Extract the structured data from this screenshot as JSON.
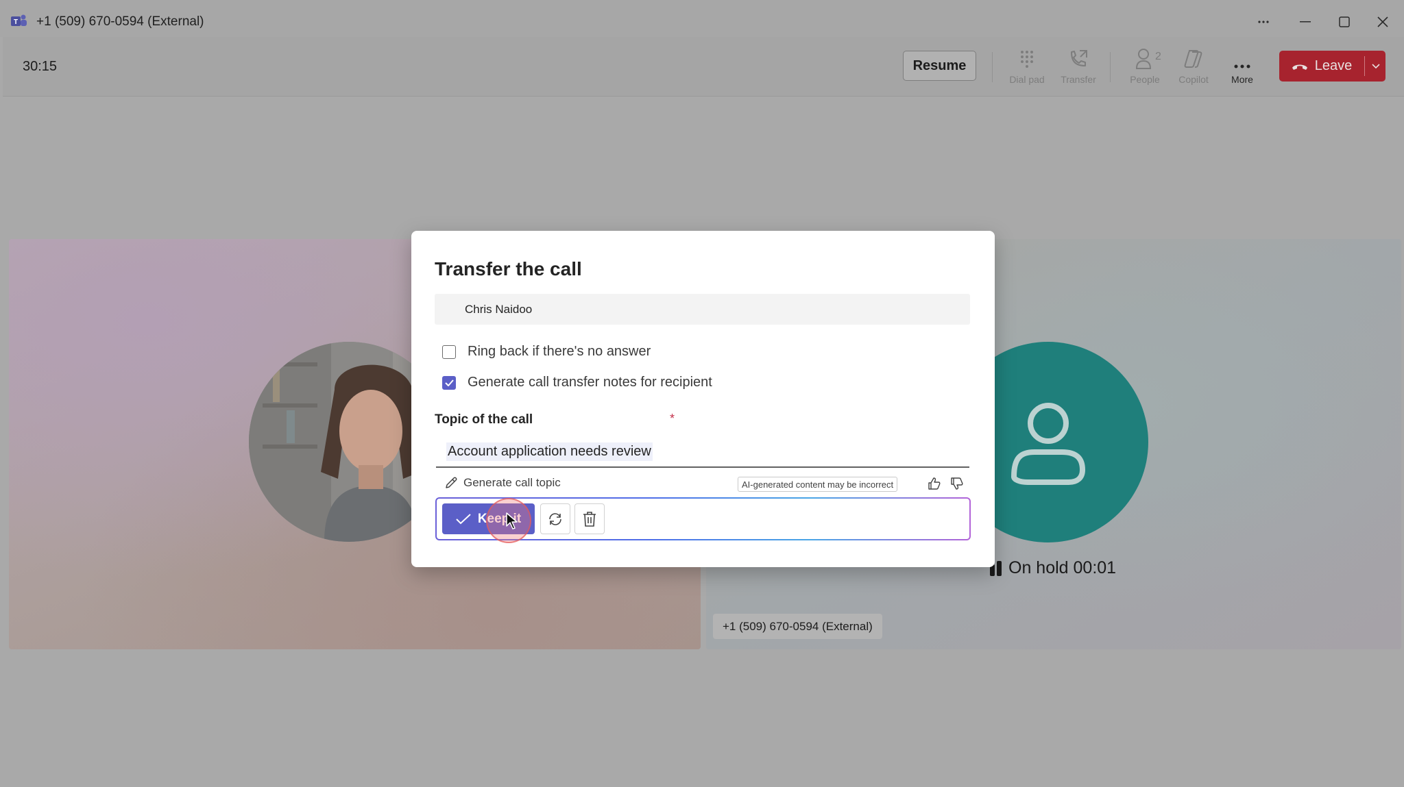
{
  "window": {
    "title": "+1 (509) 670-0594 (External)"
  },
  "toolbar": {
    "timer": "30:15",
    "resume_label": "Resume",
    "dial_pad_label": "Dial pad",
    "transfer_label": "Transfer",
    "people_label": "People",
    "people_count": "2",
    "copilot_label": "Copilot",
    "more_label": "More",
    "leave_label": "Leave"
  },
  "stage": {
    "hold_status": "On hold 00:01",
    "participant_name": "+1 (509) 670-0594 (External)"
  },
  "dialog": {
    "title": "Transfer the call",
    "recipient": "Chris Naidoo",
    "ring_back_label": "Ring back if there's no answer",
    "ring_back_checked": false,
    "generate_notes_label": "Generate call transfer notes for recipient",
    "generate_notes_checked": true,
    "topic_label": "Topic of the call",
    "required_marker": "*",
    "topic_value": "Account application needs review",
    "generate_topic_label": "Generate call topic",
    "ai_disclaimer": "AI-generated content may be incorrect",
    "keep_it_label": "Keep it"
  },
  "colors": {
    "brand_purple": "#5b5fc7",
    "leave_red": "#a7232e",
    "avatar_teal": "#1f7f7b"
  }
}
